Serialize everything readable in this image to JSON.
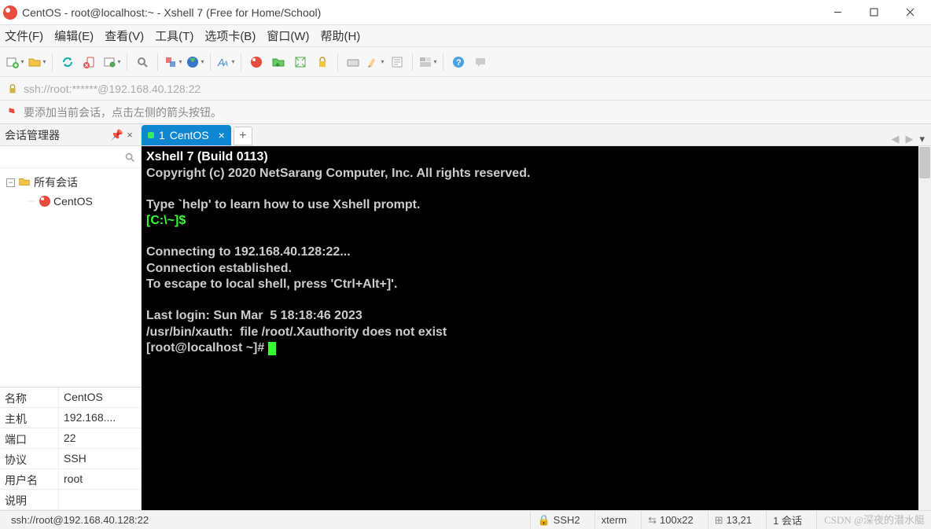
{
  "window_title": "CentOS - root@localhost:~ - Xshell 7 (Free for Home/School)",
  "menubar": [
    "文件(F)",
    "编辑(E)",
    "查看(V)",
    "工具(T)",
    "选项卡(B)",
    "窗口(W)",
    "帮助(H)"
  ],
  "address": "ssh://root:******@192.168.40.128:22",
  "hint": "要添加当前会话，点击左侧的箭头按钮。",
  "panel_title": "会话管理器",
  "tree_root": "所有会话",
  "tree_child": "CentOS",
  "props": {
    "name_k": "名称",
    "name_v": "CentOS",
    "host_k": "主机",
    "host_v": "192.168....",
    "port_k": "端口",
    "port_v": "22",
    "proto_k": "协议",
    "proto_v": "SSH",
    "user_k": "用户名",
    "user_v": "root",
    "desc_k": "说明",
    "desc_v": ""
  },
  "tab_index": "1",
  "tab_label": "CentOS",
  "terminal": {
    "header": "Xshell 7 (Build 0113)",
    "copyright": "Copyright (c) 2020 NetSarang Computer, Inc. All rights reserved.",
    "help": "Type `help' to learn how to use Xshell prompt.",
    "prompt1": "[C:\\~]$",
    "connecting": "Connecting to 192.168.40.128:22...",
    "established": "Connection established.",
    "escape": "To escape to local shell, press 'Ctrl+Alt+]'.",
    "lastlogin": "Last login: Sun Mar  5 18:18:46 2023",
    "xauth": "/usr/bin/xauth:  file /root/.Xauthority does not exist",
    "prompt2": "[root@localhost ~]# "
  },
  "status": {
    "addr": "ssh://root@192.168.40.128:22",
    "ssh": "SSH2",
    "term": "xterm",
    "size": "100x22",
    "cursor": "13,21",
    "sessions": "1 会话"
  },
  "watermark": "CSDN @深夜的潜水艇"
}
